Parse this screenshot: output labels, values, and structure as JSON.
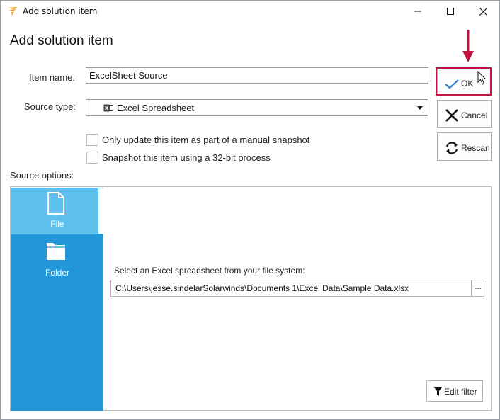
{
  "window": {
    "title": "Add solution item"
  },
  "dialog": {
    "heading": "Add solution item",
    "item_name_label": "Item name:",
    "item_name_value": "ExcelSheet Source",
    "source_type_label": "Source type:",
    "source_type_value": "Excel Spreadsheet",
    "checkboxes": [
      {
        "label": "Only update this item as part of a manual snapshot",
        "checked": false
      },
      {
        "label": "Snapshot this item using a 32-bit process",
        "checked": false
      }
    ],
    "source_options_label": "Source options:"
  },
  "buttons": {
    "ok": "OK",
    "cancel": "Cancel",
    "rescan": "Rescan"
  },
  "source_nav": {
    "items": [
      {
        "label": "File",
        "icon": "file-icon",
        "active": true
      },
      {
        "label": "Folder",
        "icon": "folder-icon",
        "active": false
      }
    ]
  },
  "file_panel": {
    "prompt": "Select an Excel spreadsheet from your file system:",
    "path": "C:\\Users\\jesse.sindelarSolarwinds\\Documents 1\\Excel Data\\Sample Data.xlsx",
    "browse_label": "...",
    "edit_filter_label": "Edit filter"
  },
  "colors": {
    "nav_background": "#2196d8",
    "nav_active": "#5ec0ee",
    "highlight": "#c0163f",
    "ok_check": "#2f7fd6"
  }
}
